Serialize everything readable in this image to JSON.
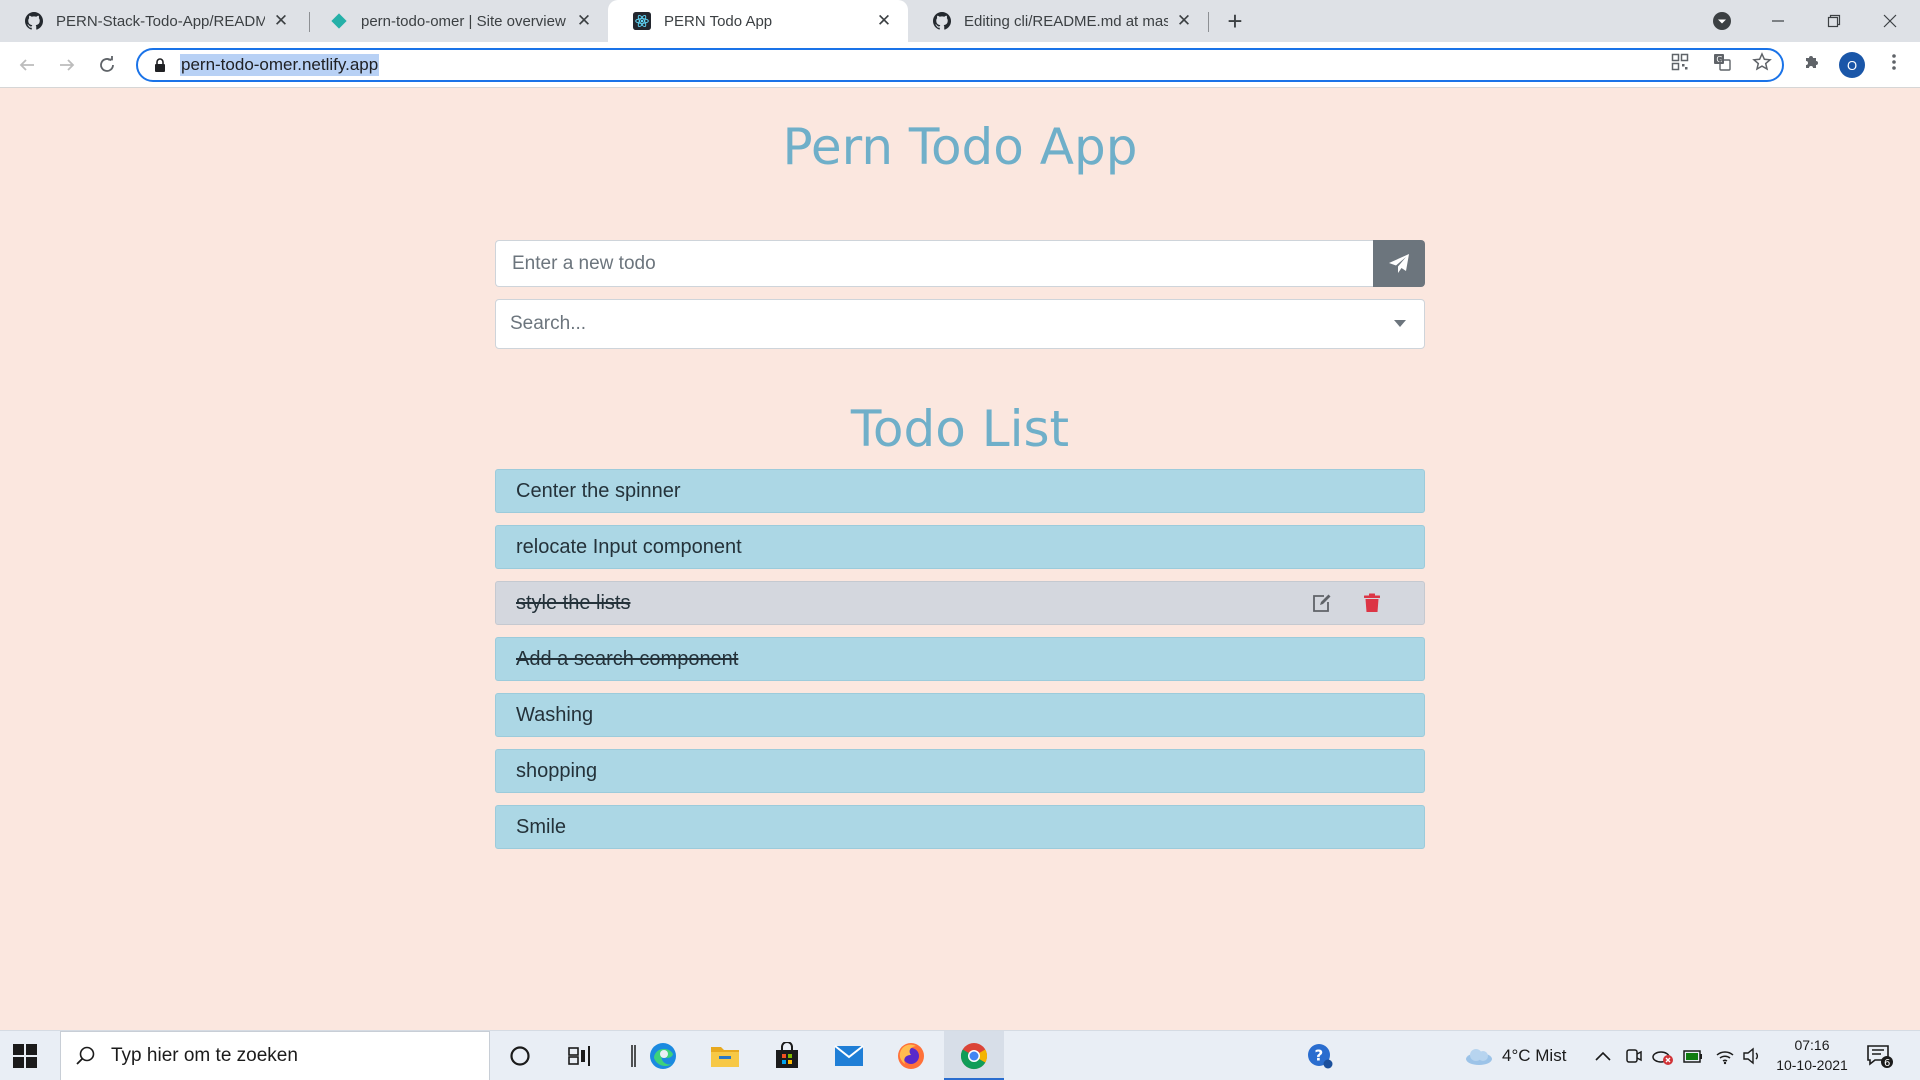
{
  "browser": {
    "tabs": [
      {
        "title": "PERN-Stack-Todo-App/README.",
        "icon": "github-icon"
      },
      {
        "title": "pern-todo-omer | Site overview",
        "icon": "netlify-icon"
      },
      {
        "title": "PERN Todo App",
        "icon": "react-icon",
        "active": true
      },
      {
        "title": "Editing cli/README.md at master",
        "icon": "github-icon"
      }
    ],
    "url": "pern-todo-omer.netlify.app",
    "profile_initial": "O"
  },
  "app": {
    "title": "Pern Todo App",
    "todo_input_placeholder": "Enter a new todo",
    "search_placeholder": "Search...",
    "list_title": "Todo List",
    "todos": [
      {
        "text": "Center the spinner",
        "done": false
      },
      {
        "text": "relocate Input component",
        "done": false
      },
      {
        "text": "style the lists",
        "done": true,
        "hovered": true
      },
      {
        "text": "Add a search component",
        "done": true
      },
      {
        "text": "Washing",
        "done": false
      },
      {
        "text": "shopping",
        "done": false
      },
      {
        "text": "Smile",
        "done": false
      }
    ]
  },
  "taskbar": {
    "search_text": "Typ hier om te zoeken",
    "weather": "4°C  Mist",
    "time": "07:16",
    "date": "10-10-2021",
    "notification_count": "6"
  },
  "colors": {
    "page_bg": "#fbe7df",
    "title_color": "#6fafc9",
    "item_bg": "#acd7e5",
    "item_hover_bg": "#d4d7de",
    "delete_color": "#dc3545"
  }
}
